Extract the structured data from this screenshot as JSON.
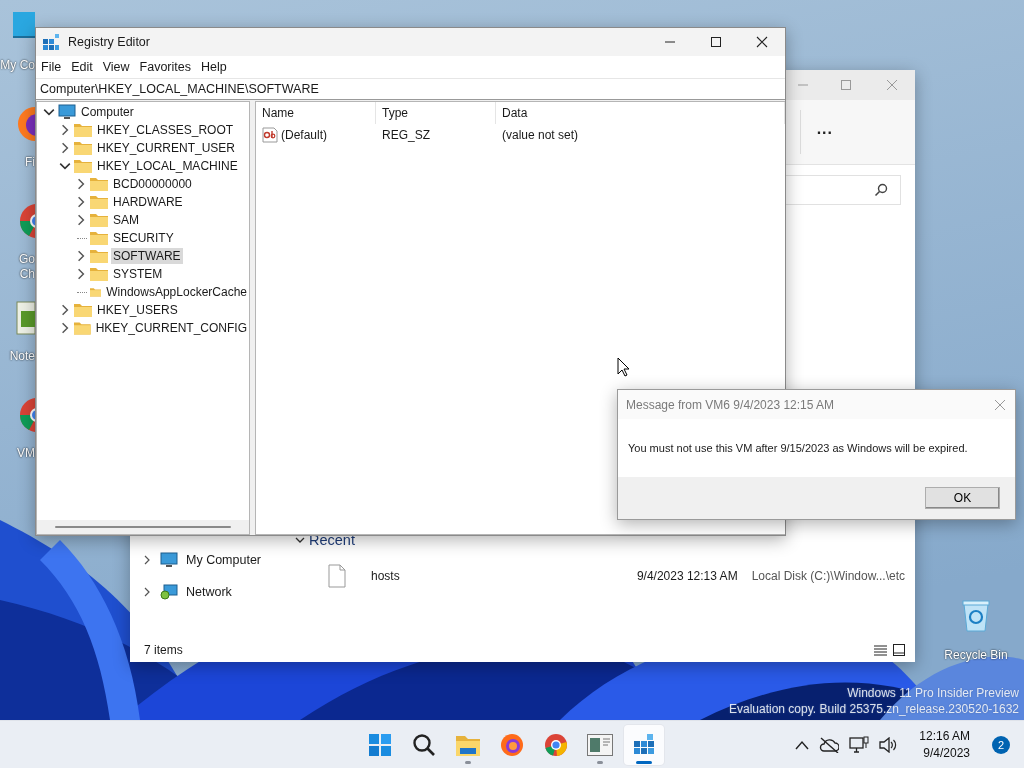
{
  "desktop": {
    "icons": [
      {
        "kind": "monitor",
        "lines": [
          "My Co"
        ]
      },
      {
        "kind": "firefox",
        "lines": [
          "Fi"
        ]
      },
      {
        "kind": "chrome",
        "lines": [
          "Go",
          "Ch"
        ]
      },
      {
        "kind": "notepad",
        "lines": [
          "Note"
        ]
      },
      {
        "kind": "chrome",
        "lines": [
          "VM"
        ]
      }
    ],
    "recycle_bin": {
      "label": "Recycle Bin"
    },
    "watermark": [
      "Windows 11 Pro Insider Preview",
      "Evaluation copy. Build 25375.zn_release.230520-1632"
    ]
  },
  "explorer": {
    "more": "...",
    "nav": [
      {
        "kind": "computer",
        "label": "My Computer"
      },
      {
        "kind": "network",
        "label": "Network"
      }
    ],
    "section": {
      "title": "Recent",
      "expanded": true
    },
    "files": [
      {
        "name": "hosts",
        "date": "9/4/2023 12:13 AM",
        "location": "Local Disk (C:)\\Window...\\etc"
      }
    ],
    "status": "7 items"
  },
  "registry_editor": {
    "title": "Registry Editor",
    "menu": [
      "File",
      "Edit",
      "View",
      "Favorites",
      "Help"
    ],
    "address": "Computer\\HKEY_LOCAL_MACHINE\\SOFTWARE",
    "tree": [
      {
        "label": "Computer",
        "expandable": true,
        "expanded": true,
        "selected": false,
        "children": [
          {
            "label": "HKEY_CLASSES_ROOT",
            "expandable": true,
            "expanded": false,
            "selected": false
          },
          {
            "label": "HKEY_CURRENT_USER",
            "expandable": true,
            "expanded": false,
            "selected": false
          },
          {
            "label": "HKEY_LOCAL_MACHINE",
            "expandable": true,
            "expanded": true,
            "selected": false,
            "children": [
              {
                "label": "BCD00000000",
                "expandable": true,
                "expanded": false,
                "selected": false
              },
              {
                "label": "HARDWARE",
                "expandable": true,
                "expanded": false,
                "selected": false
              },
              {
                "label": "SAM",
                "expandable": true,
                "expanded": false,
                "selected": false
              },
              {
                "label": "SECURITY",
                "expandable": false,
                "selected": false
              },
              {
                "label": "SOFTWARE",
                "expandable": true,
                "expanded": false,
                "selected": true
              },
              {
                "label": "SYSTEM",
                "expandable": true,
                "expanded": false,
                "selected": false
              },
              {
                "label": "WindowsAppLockerCache",
                "expandable": false,
                "selected": false
              }
            ]
          },
          {
            "label": "HKEY_USERS",
            "expandable": true,
            "expanded": false,
            "selected": false
          },
          {
            "label": "HKEY_CURRENT_CONFIG",
            "expandable": true,
            "expanded": false,
            "selected": false
          }
        ]
      }
    ],
    "columns": [
      "Name",
      "Type",
      "Data"
    ],
    "values": [
      {
        "name": "(Default)",
        "type": "REG_SZ",
        "data": "(value not set)"
      }
    ]
  },
  "dialog": {
    "title": "Message from VM6 9/4/2023 12:15 AM",
    "message": "You must not use this VM after 9/15/2023 as Windows will be expired.",
    "button": "OK"
  },
  "taskbar": {
    "apps": [
      {
        "kind": "start",
        "running": false,
        "active": false
      },
      {
        "kind": "search",
        "running": false,
        "active": false
      },
      {
        "kind": "explorer",
        "running": true,
        "active": false
      },
      {
        "kind": "firefox",
        "running": false,
        "active": false
      },
      {
        "kind": "chrome",
        "running": false,
        "active": false
      },
      {
        "kind": "window",
        "running": true,
        "active": false
      },
      {
        "kind": "regedit",
        "running": true,
        "active": true
      }
    ],
    "clock": {
      "time": "12:16 AM",
      "date": "9/4/2023"
    },
    "notifications": "2"
  }
}
